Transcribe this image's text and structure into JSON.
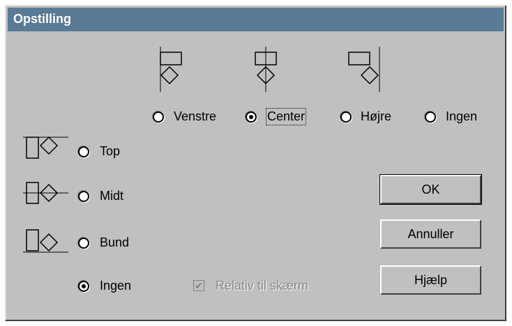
{
  "dialog": {
    "title": "Opstilling"
  },
  "horizontal": {
    "options": [
      {
        "label": "Venstre",
        "checked": false
      },
      {
        "label": "Center",
        "checked": true
      },
      {
        "label": "Højre",
        "checked": false
      },
      {
        "label": "Ingen",
        "checked": false
      }
    ]
  },
  "vertical": {
    "options": [
      {
        "label": "Top",
        "checked": false
      },
      {
        "label": "Midt",
        "checked": false
      },
      {
        "label": "Bund",
        "checked": false
      },
      {
        "label": "Ingen",
        "checked": true
      }
    ]
  },
  "relative": {
    "label": "Relativ til skærm",
    "checked": true,
    "enabled": false
  },
  "buttons": {
    "ok": "OK",
    "cancel": "Annuller",
    "help": "Hjælp"
  }
}
